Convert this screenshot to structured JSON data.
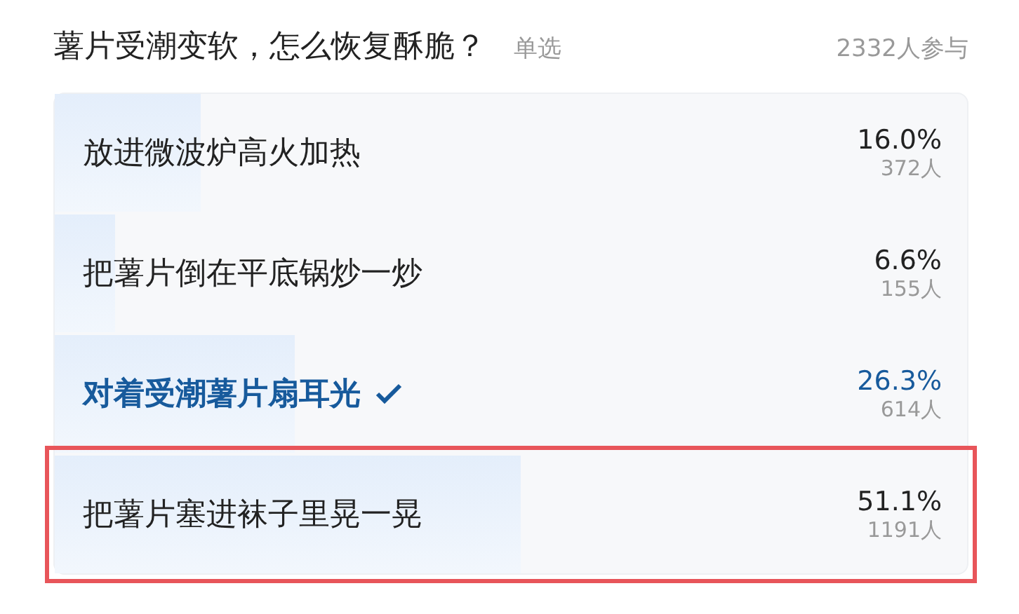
{
  "poll": {
    "question": "薯片受潮变软，怎么恢复酥脆？",
    "mode": "单选",
    "participants": "2332人参与"
  },
  "options": [
    {
      "label": "放进微波炉高火加热",
      "percent": "16.0%",
      "count": "372人",
      "level": 0.16,
      "selected": false,
      "highlighted": false
    },
    {
      "label": "把薯片倒在平底锅炒一炒",
      "percent": "6.6%",
      "count": "155人",
      "level": 0.066,
      "selected": false,
      "highlighted": false
    },
    {
      "label": "对着受潮薯片扇耳光",
      "percent": "26.3%",
      "count": "614人",
      "level": 0.263,
      "selected": true,
      "highlighted": false
    },
    {
      "label": "把薯片塞进袜子里晃一晃",
      "percent": "51.1%",
      "count": "1191人",
      "level": 0.511,
      "selected": false,
      "highlighted": true
    }
  ]
}
